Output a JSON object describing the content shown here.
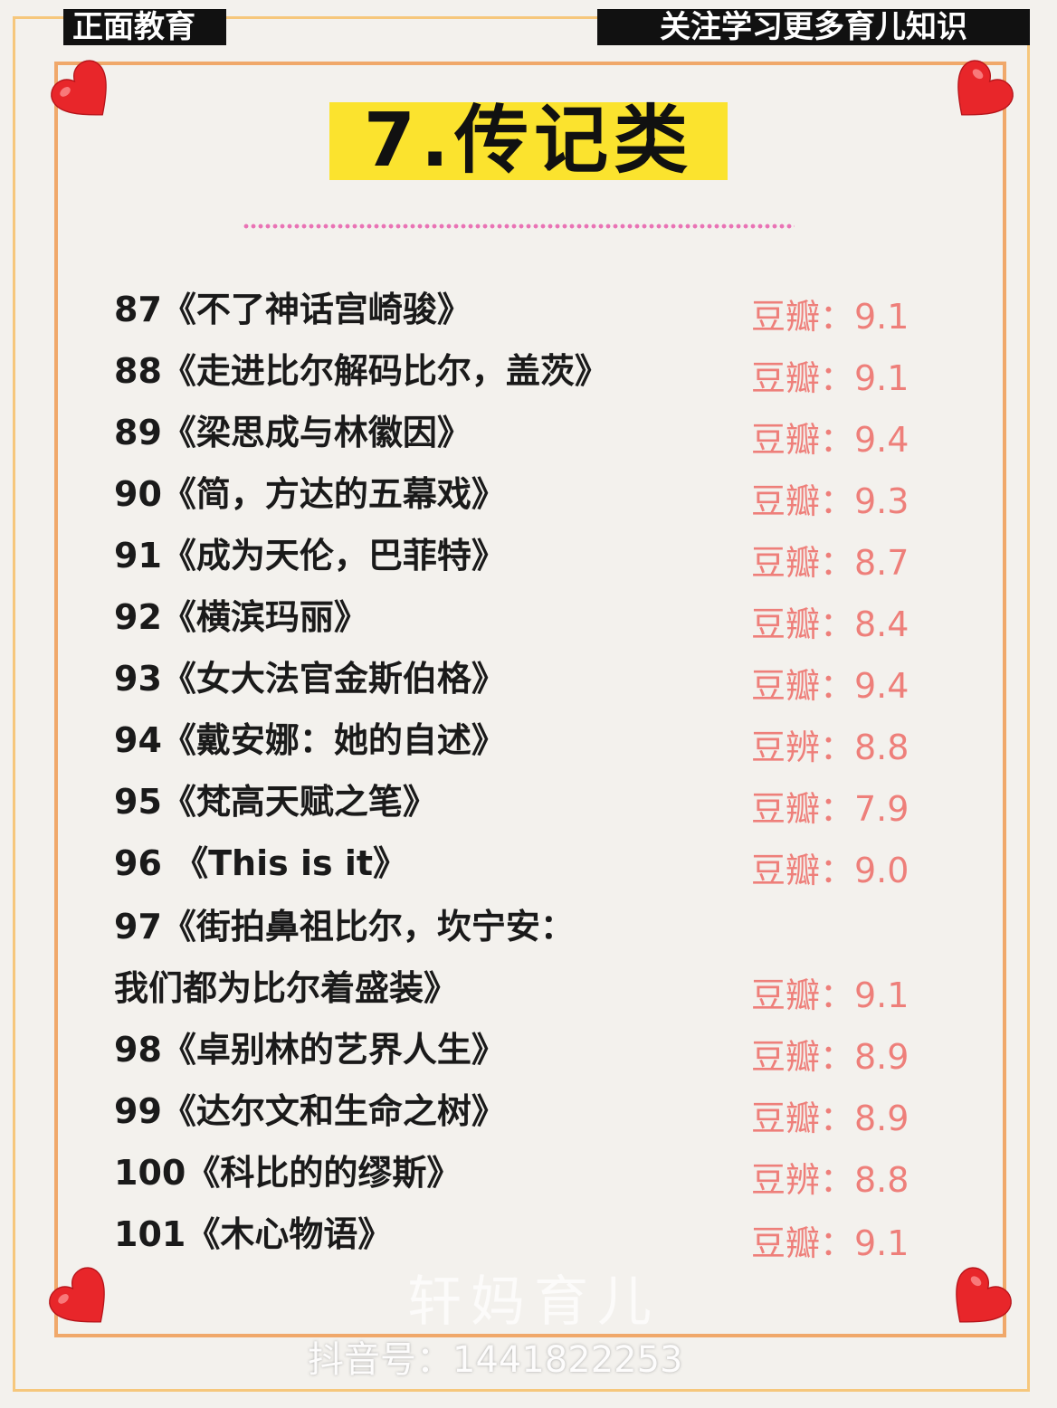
{
  "header": {
    "left_tag": "正面教育",
    "right_tag": "关注学习更多育儿知识",
    "title": "7.传记类"
  },
  "books": [
    {
      "title": "87《不了神话宫崎骏》",
      "rating": "豆瓣：9.1"
    },
    {
      "title": "88《走进比尔解码比尔，盖茨》",
      "rating": "豆瓣：9.1"
    },
    {
      "title": "89《梁思成与林徽因》",
      "rating": "豆瓣：9.4"
    },
    {
      "title": "90《简，方达的五幕戏》",
      "rating": "豆瓣：9.3"
    },
    {
      "title": "91《成为天伦，巴菲特》",
      "rating": "豆瓣：8.7"
    },
    {
      "title": "92《横滨玛丽》",
      "rating": "豆瓣：8.4"
    },
    {
      "title": "93《女大法官金斯伯格》",
      "rating": "豆瓣：9.4"
    },
    {
      "title": "94《戴安娜：她的自述》",
      "rating": "豆辨：8.8"
    },
    {
      "title": "95《梵高天赋之笔》",
      "rating": "豆瓣：7.9"
    },
    {
      "title": "96 《This is it》",
      "rating": "豆瓣：9.0"
    },
    {
      "title": "97《街拍鼻祖比尔，坎宁安：",
      "rating": ""
    },
    {
      "title": "我们都为比尔着盛装》",
      "rating": "豆瓣：9.1"
    },
    {
      "title": "98《卓别林的艺界人生》",
      "rating": "豆瓣：8.9"
    },
    {
      "title": "99《达尔文和生命之树》",
      "rating": "豆瓣：8.9"
    },
    {
      "title": "100《科比的的缪斯》",
      "rating": "豆辨：8.8"
    },
    {
      "title": "101《木心物语》",
      "rating": "豆瓣：9.1"
    }
  ],
  "watermark": {
    "name": "轩妈育儿",
    "douyin_id": "抖音号：1441822253"
  },
  "colors": {
    "title_bg": "#fbe32e",
    "rating": "#ee7f7a",
    "heart": "#e8262a",
    "frame": "#f0a86a"
  }
}
